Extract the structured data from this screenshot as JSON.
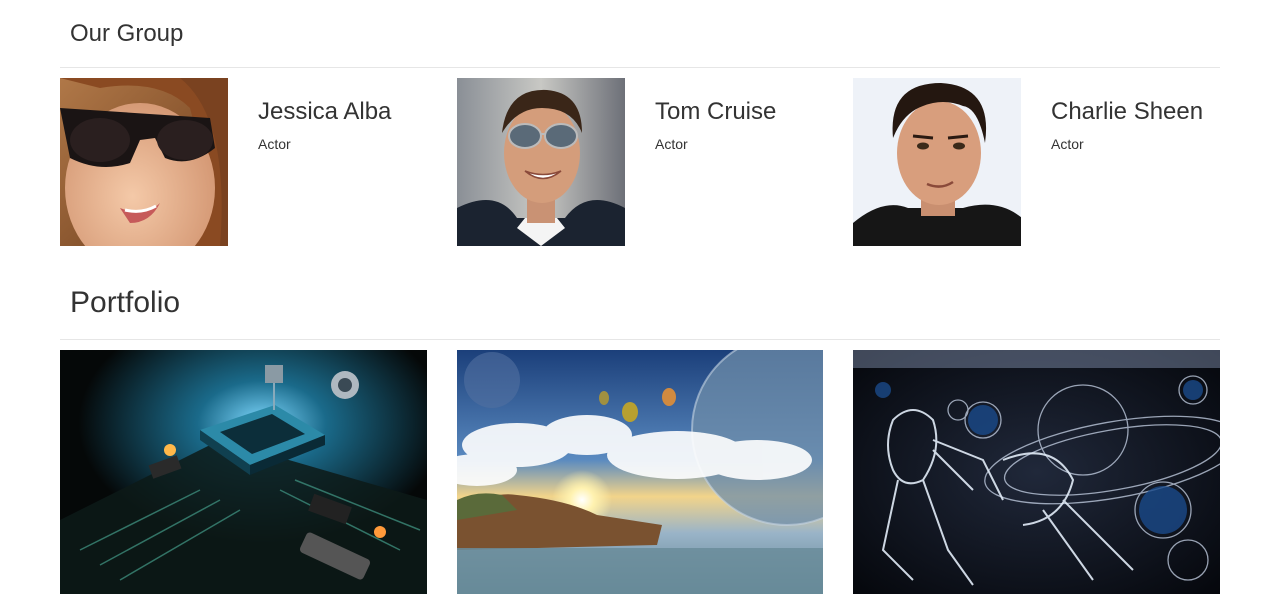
{
  "group": {
    "title": "Our Group",
    "members": [
      {
        "name": "Jessica Alba",
        "role": "Actor"
      },
      {
        "name": "Tom Cruise",
        "role": "Actor"
      },
      {
        "name": "Charlie Sheen",
        "role": "Actor"
      }
    ]
  },
  "portfolio": {
    "title": "Portfolio",
    "items": [
      {
        "subject": "circuit-board-artwork"
      },
      {
        "subject": "sky-island-landscape"
      },
      {
        "subject": "space-robot-artwork"
      }
    ]
  },
  "colors": {
    "text": "#333333",
    "divider": "#e6e6e6",
    "background": "#ffffff"
  }
}
